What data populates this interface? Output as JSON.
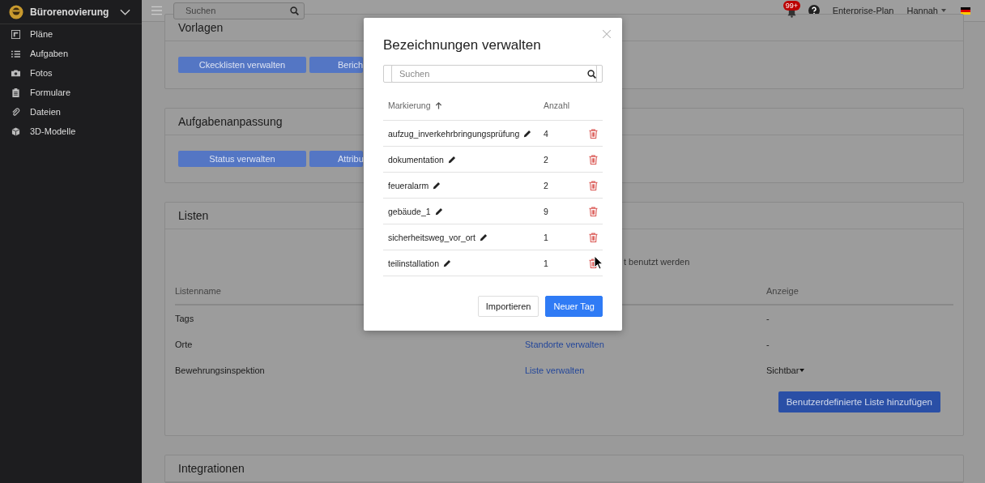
{
  "sidebar": {
    "project": "Bürorenovierung",
    "items": [
      {
        "label": "Pläne",
        "kind": "plans"
      },
      {
        "label": "Aufgaben",
        "kind": "tasks"
      },
      {
        "label": "Fotos",
        "kind": "photos"
      },
      {
        "label": "Formulare",
        "kind": "forms"
      },
      {
        "label": "Dateien",
        "kind": "files"
      },
      {
        "label": "3D-Modelle",
        "kind": "models"
      }
    ]
  },
  "topbar": {
    "search_placeholder": "Suchen",
    "notifications": "99+",
    "plan": "Enterprise-Plan",
    "user": "Hannah"
  },
  "cards": [
    {
      "title": "Vorlagen",
      "buttons": [
        "Ckecklisten verwalten",
        "Berich"
      ]
    },
    {
      "title": "Aufgabenanpassung",
      "buttons": [
        "Status verwalten",
        "Attribu"
      ]
    }
  ],
  "lists_card": {
    "title": "Listen",
    "note": "t benutzt werden",
    "columns": [
      "Listenname",
      "Anzeige"
    ],
    "rows": [
      {
        "name": "Tags",
        "display": "-",
        "kind": "text"
      },
      {
        "name": "Orte",
        "link": "Standorte verwalten",
        "display": "-",
        "kind": "text"
      },
      {
        "name": "Bewehrungsinspektion",
        "link": "Liste verwalten",
        "display": "Sichtbar",
        "kind": "dropdown"
      }
    ],
    "add_button": "Benutzerdefinierte Liste hinzufügen"
  },
  "integrations": {
    "title": "Integrationen"
  },
  "modal": {
    "title": "Bezeichnungen verwalten",
    "search_placeholder": "Suchen",
    "columns": [
      "Markierung",
      "Anzahl"
    ],
    "rows": [
      {
        "label": "aufzug_inverkehrbringungsprüfung",
        "count": "4"
      },
      {
        "label": "dokumentation",
        "count": "2"
      },
      {
        "label": "feueralarm",
        "count": "2"
      },
      {
        "label": "gebäude_1",
        "count": "9"
      },
      {
        "label": "sicherheitsweg_vor_ort",
        "count": "1"
      },
      {
        "label": "teilinstallation",
        "count": "1"
      }
    ],
    "buttons": [
      {
        "label": "Importieren",
        "kind": "secondary"
      },
      {
        "label": "Neuer Tag",
        "kind": "primary"
      }
    ]
  }
}
